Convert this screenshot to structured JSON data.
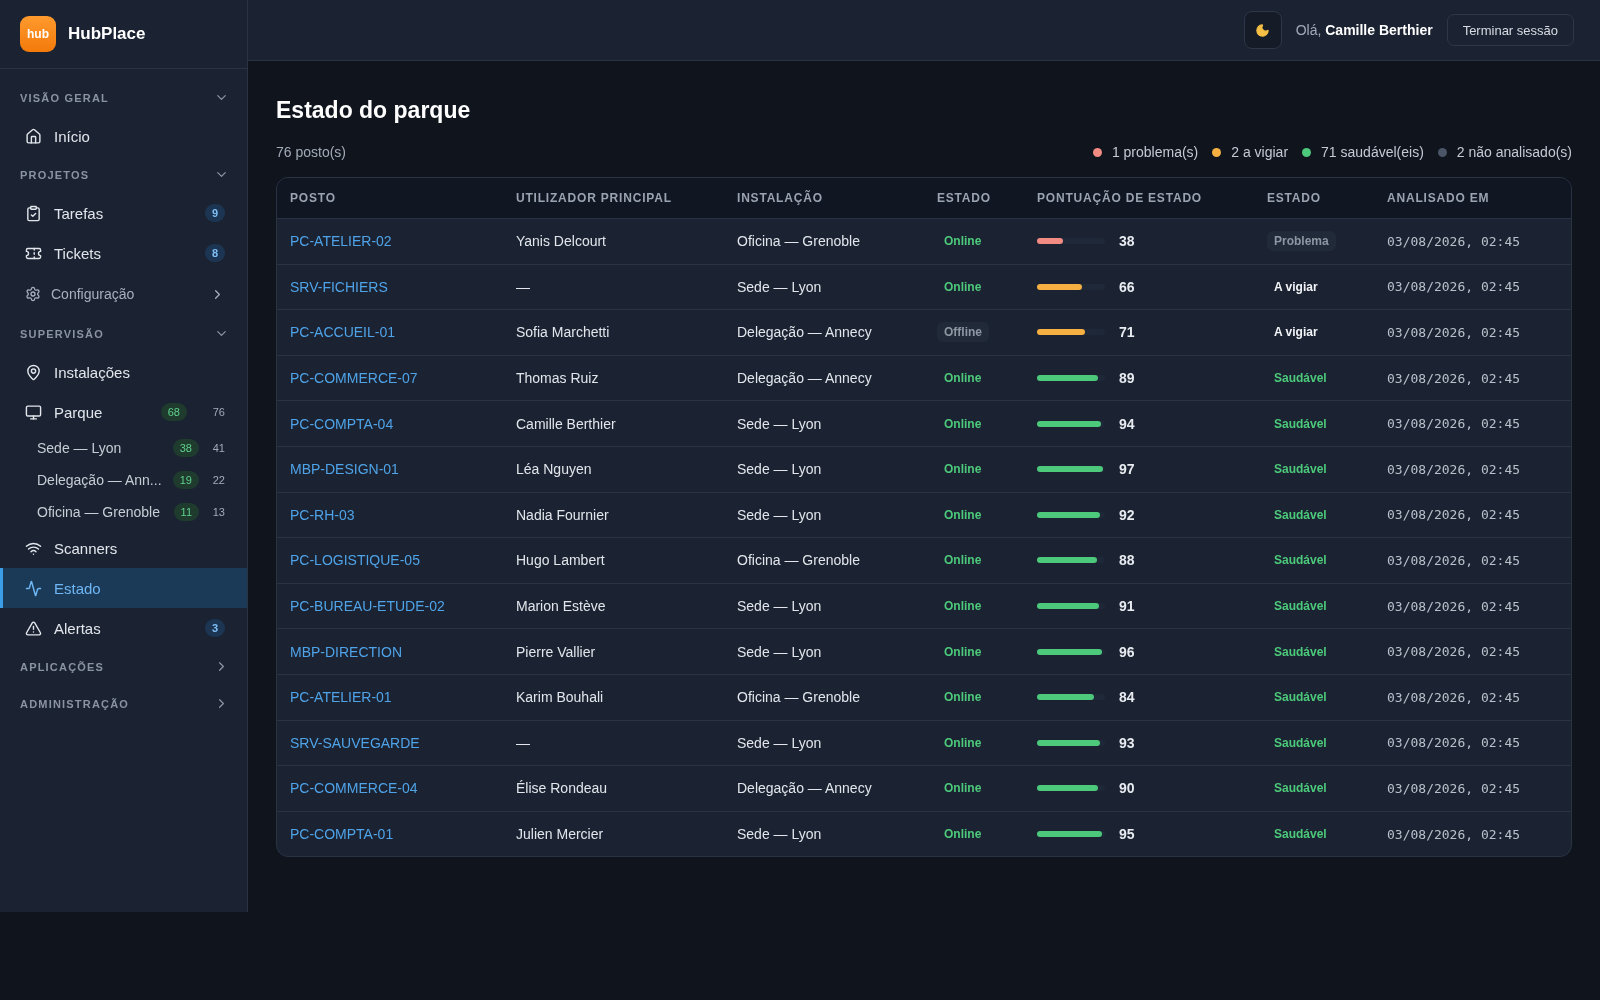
{
  "brand": {
    "logo": "hub",
    "name": "HubPlace"
  },
  "sidebar": {
    "sections": [
      {
        "title": "VISÃO GERAL",
        "expanded": true,
        "items": [
          {
            "kind": "link",
            "label": "Início",
            "selected": false
          }
        ]
      },
      {
        "title": "PROJETOS",
        "expanded": true,
        "items": [
          {
            "kind": "link",
            "label": "Tarefas",
            "selected": false,
            "count": "9"
          },
          {
            "kind": "link",
            "label": "Tickets",
            "selected": false,
            "count": "8"
          },
          {
            "kind": "group",
            "label": "Configuração",
            "expanded": false
          }
        ]
      },
      {
        "title": "SUPERVISÃO",
        "expanded": true,
        "items": [
          {
            "kind": "link",
            "label": "Instalações",
            "selected": false
          },
          {
            "kind": "link",
            "label": "Parque",
            "selected": false,
            "healthy": "68",
            "total": "76",
            "children": [
              {
                "label": "Sede — Lyon",
                "healthy": "38",
                "total": "41"
              },
              {
                "label": "Delegação — Ann...",
                "healthy": "19",
                "total": "22"
              },
              {
                "label": "Oficina — Grenoble",
                "healthy": "11",
                "total": "13"
              }
            ]
          },
          {
            "kind": "link",
            "label": "Scanners",
            "selected": false
          },
          {
            "kind": "link",
            "label": "Estado",
            "selected": true
          },
          {
            "kind": "link",
            "label": "Alertas",
            "selected": false,
            "count": "3"
          }
        ]
      },
      {
        "title": "APLICAÇÕES",
        "expanded": false
      },
      {
        "title": "ADMINISTRAÇÃO",
        "expanded": false
      }
    ]
  },
  "header": {
    "greeting": "Olá,",
    "user": "Camille Berthier",
    "logout": "Terminar sessão"
  },
  "page": {
    "title": "Estado do parque",
    "count": "76 posto(s)",
    "legend": [
      {
        "label": "1 problema(s)",
        "color": "#f28b82"
      },
      {
        "label": "2 a vigiar",
        "color": "#f5b041"
      },
      {
        "label": "71 saudável(eis)",
        "color": "#4cc97a"
      },
      {
        "label": "2 não analisado(s)",
        "color": "#4a5568"
      }
    ]
  },
  "table": {
    "columns": [
      "POSTO",
      "UTILIZADOR PRINCIPAL",
      "INSTALAÇÃO",
      "ESTADO",
      "PONTUAÇÃO DE ESTADO",
      "ESTADO",
      "ANALISADO EM"
    ],
    "rows": [
      {
        "host": "PC-ATELIER-02",
        "user": "Yanis Delcourt",
        "site": "Oficina — Grenoble",
        "connection": "Online",
        "online": true,
        "level": 0.38,
        "score": "38",
        "health": "Problema",
        "kind": "problem",
        "scanned": "03/08/2026, 02:45"
      },
      {
        "host": "SRV-FICHIERS",
        "user": "—",
        "site": "Sede — Lyon",
        "connection": "Online",
        "online": true,
        "level": 0.66,
        "score": "66",
        "health": "A vigiar",
        "kind": "watch",
        "scanned": "03/08/2026, 02:45"
      },
      {
        "host": "PC-ACCUEIL-01",
        "user": "Sofia Marchetti",
        "site": "Delegação — Annecy",
        "connection": "Offline",
        "online": false,
        "level": 0.71,
        "score": "71",
        "health": "A vigiar",
        "kind": "watch",
        "scanned": "03/08/2026, 02:45"
      },
      {
        "host": "PC-COMMERCE-07",
        "user": "Thomas Ruiz",
        "site": "Delegação — Annecy",
        "connection": "Online",
        "online": true,
        "level": 0.89,
        "score": "89",
        "health": "Saudável",
        "kind": "healthy",
        "scanned": "03/08/2026, 02:45"
      },
      {
        "host": "PC-COMPTA-04",
        "user": "Camille Berthier",
        "site": "Sede — Lyon",
        "connection": "Online",
        "online": true,
        "level": 0.94,
        "score": "94",
        "health": "Saudável",
        "kind": "healthy",
        "scanned": "03/08/2026, 02:45"
      },
      {
        "host": "MBP-DESIGN-01",
        "user": "Léa Nguyen",
        "site": "Sede — Lyon",
        "connection": "Online",
        "online": true,
        "level": 0.97,
        "score": "97",
        "health": "Saudável",
        "kind": "healthy",
        "scanned": "03/08/2026, 02:45"
      },
      {
        "host": "PC-RH-03",
        "user": "Nadia Fournier",
        "site": "Sede — Lyon",
        "connection": "Online",
        "online": true,
        "level": 0.92,
        "score": "92",
        "health": "Saudável",
        "kind": "healthy",
        "scanned": "03/08/2026, 02:45"
      },
      {
        "host": "PC-LOGISTIQUE-05",
        "user": "Hugo Lambert",
        "site": "Oficina — Grenoble",
        "connection": "Online",
        "online": true,
        "level": 0.88,
        "score": "88",
        "health": "Saudável",
        "kind": "healthy",
        "scanned": "03/08/2026, 02:45"
      },
      {
        "host": "PC-BUREAU-ETUDE-02",
        "user": "Marion Estève",
        "site": "Sede — Lyon",
        "connection": "Online",
        "online": true,
        "level": 0.91,
        "score": "91",
        "health": "Saudável",
        "kind": "healthy",
        "scanned": "03/08/2026, 02:45"
      },
      {
        "host": "MBP-DIRECTION",
        "user": "Pierre Vallier",
        "site": "Sede — Lyon",
        "connection": "Online",
        "online": true,
        "level": 0.96,
        "score": "96",
        "health": "Saudável",
        "kind": "healthy",
        "scanned": "03/08/2026, 02:45"
      },
      {
        "host": "PC-ATELIER-01",
        "user": "Karim Bouhali",
        "site": "Oficina — Grenoble",
        "connection": "Online",
        "online": true,
        "level": 0.84,
        "score": "84",
        "health": "Saudável",
        "kind": "healthy",
        "scanned": "03/08/2026, 02:45"
      },
      {
        "host": "SRV-SAUVEGARDE",
        "user": "—",
        "site": "Sede — Lyon",
        "connection": "Online",
        "online": true,
        "level": 0.93,
        "score": "93",
        "health": "Saudável",
        "kind": "healthy",
        "scanned": "03/08/2026, 02:45"
      },
      {
        "host": "PC-COMMERCE-04",
        "user": "Élise Rondeau",
        "site": "Delegação — Annecy",
        "connection": "Online",
        "online": true,
        "level": 0.9,
        "score": "90",
        "health": "Saudável",
        "kind": "healthy",
        "scanned": "03/08/2026, 02:45"
      },
      {
        "host": "PC-COMPTA-01",
        "user": "Julien Mercier",
        "site": "Sede — Lyon",
        "connection": "Online",
        "online": true,
        "level": 0.95,
        "score": "95",
        "health": "Saudável",
        "kind": "healthy",
        "scanned": "03/08/2026, 02:45"
      }
    ]
  }
}
